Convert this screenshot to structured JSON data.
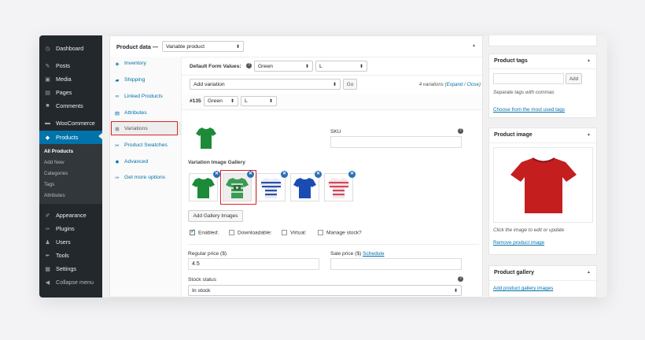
{
  "sidebar": {
    "items": [
      {
        "label": "Dashboard",
        "icon": "dashboard-icon",
        "glyph": "◷"
      },
      {
        "label": "Posts",
        "icon": "pin-icon",
        "glyph": "✎"
      },
      {
        "label": "Media",
        "icon": "media-icon",
        "glyph": "▣"
      },
      {
        "label": "Pages",
        "icon": "pages-icon",
        "glyph": "▤"
      },
      {
        "label": "Comments",
        "icon": "comment-icon",
        "glyph": "■"
      },
      {
        "label": "WooCommerce",
        "icon": "woocommerce-icon",
        "glyph": "▬"
      },
      {
        "label": "Products",
        "icon": "products-icon",
        "glyph": "◆"
      },
      {
        "label": "Appearance",
        "icon": "brush-icon",
        "glyph": "✐"
      },
      {
        "label": "Plugins",
        "icon": "plugin-icon",
        "glyph": "✑"
      },
      {
        "label": "Users",
        "icon": "users-icon",
        "glyph": "♟"
      },
      {
        "label": "Tools",
        "icon": "wrench-icon",
        "glyph": "✒"
      },
      {
        "label": "Settings",
        "icon": "settings-icon",
        "glyph": "▦"
      },
      {
        "label": "Collapse menu",
        "icon": "collapse-icon",
        "glyph": "◀"
      }
    ],
    "submenu": [
      "All Products",
      "Add New",
      "Categories",
      "Tags",
      "Attributes"
    ]
  },
  "product_data": {
    "title": "Product data —",
    "type_select": "Variable product",
    "tabs": [
      {
        "label": "Inventory",
        "icon": "inventory-icon",
        "glyph": "◈"
      },
      {
        "label": "Shipping",
        "icon": "truck-icon",
        "glyph": "▰"
      },
      {
        "label": "Linked Products",
        "icon": "link-icon",
        "glyph": "∞"
      },
      {
        "label": "Attributes",
        "icon": "attributes-icon",
        "glyph": "▤"
      },
      {
        "label": "Variations",
        "icon": "grid-icon",
        "glyph": "⊞"
      },
      {
        "label": "Product Swatches",
        "icon": "swatch-icon",
        "glyph": "✂"
      },
      {
        "label": "Advanced",
        "icon": "gear-icon",
        "glyph": "✹"
      },
      {
        "label": "Get more options",
        "icon": "plugin-icon",
        "glyph": "✑"
      }
    ],
    "default_form_label": "Default Form Values:",
    "default_color": "Green",
    "default_size": "L",
    "add_variation": "Add variation",
    "go": "Go",
    "variations_count": "4 variations",
    "expand": "Expand",
    "sep": "/",
    "close": "Close",
    "variation_id": "#135",
    "variation_color": "Green",
    "variation_size": "L",
    "sku_label": "SKU",
    "sku_value": "",
    "gallery_label": "Variation Image Gallery",
    "add_gallery": "Add Gallery Images",
    "enabled": "Enabled:",
    "downloadable": "Downloadable:",
    "virtual": "Virtual:",
    "manage_stock": "Manage stock?",
    "regular_price_label": "Regular price ($)",
    "regular_price": "4.5",
    "sale_price_label": "Sale price ($)",
    "schedule": "Schedule",
    "sale_price": "",
    "stock_status_label": "Stock status",
    "stock_status": "In stock",
    "help": "?"
  },
  "right": {
    "tags_title": "Product tags",
    "tags_input": "",
    "add": "Add",
    "tags_hint": "Separate tags with commas",
    "tags_link": "Choose from the most used tags",
    "image_title": "Product image",
    "image_hint": "Click the image to edit or update",
    "remove_image": "Remove product image",
    "gallery_title": "Product gallery",
    "gallery_link": "Add product gallery images"
  },
  "colors": {
    "accent": "#0073aa",
    "sidebar": "#23282d",
    "highlight": "#e02424",
    "shirt_red": "#c41e1e",
    "shirt_green": "#1d8a3a",
    "shirt_blue": "#1a4cb3"
  }
}
